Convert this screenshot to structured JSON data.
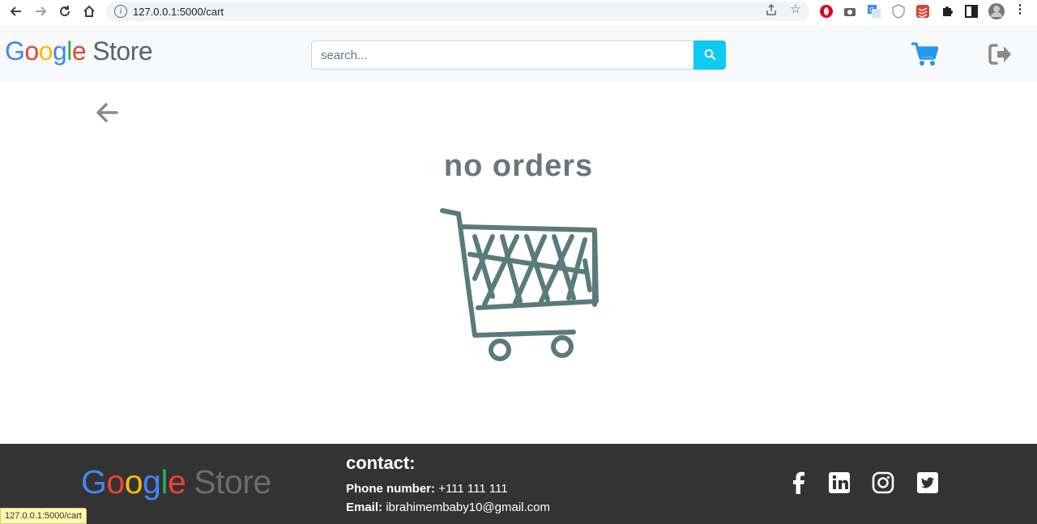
{
  "browser": {
    "url": "127.0.0.1:5000/cart",
    "status_url": "127.0.0.1:5000/cart"
  },
  "header": {
    "logo_google": [
      "G",
      "o",
      "o",
      "g",
      "l",
      "e"
    ],
    "logo_store": "Store",
    "search_placeholder": "search..."
  },
  "main": {
    "empty_message": "no orders"
  },
  "footer": {
    "logo_store": "Store",
    "contact_title": "contact:",
    "phone_label": "Phone number:",
    "phone_value": "+111 111 111",
    "email_label": "Email:",
    "email_value": "ibrahimembaby10@gmail.com"
  },
  "colors": {
    "google_blue": "#4285F4",
    "google_red": "#EA4335",
    "google_yellow": "#FBBC05",
    "google_green": "#34A853",
    "accent_cyan": "#0dcaf0",
    "cart_blue": "#2196f3",
    "illustration": "#5b7b7b",
    "footer_bg": "#333333"
  },
  "icons": [
    "back-icon",
    "forward-icon",
    "reload-icon",
    "home-icon",
    "info-icon",
    "share-icon",
    "star-icon",
    "search-icon",
    "cart-icon",
    "logout-icon",
    "arrow-left-icon",
    "facebook-icon",
    "linkedin-icon",
    "instagram-icon",
    "twitter-icon"
  ]
}
